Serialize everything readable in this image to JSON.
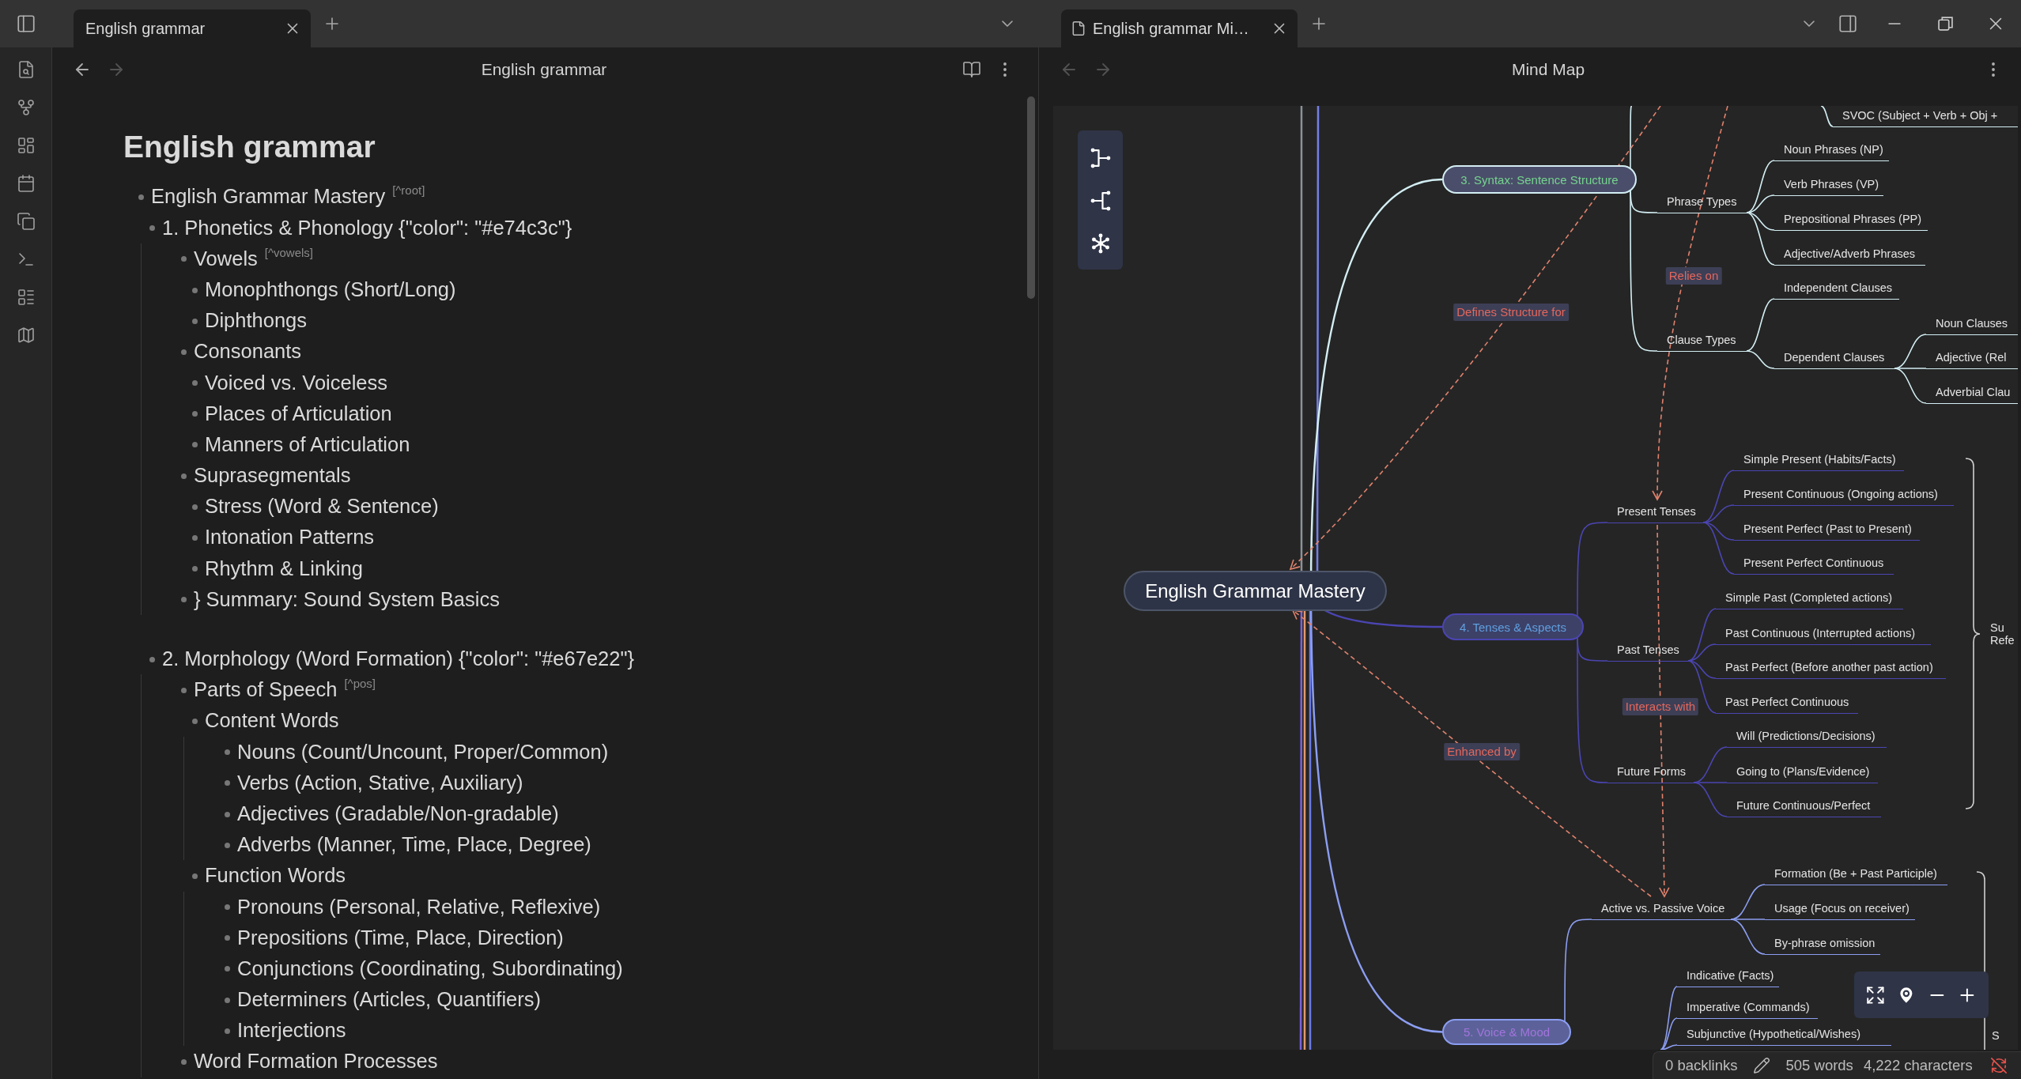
{
  "left_pane": {
    "tabs": [
      {
        "label": "English grammar",
        "selected": true
      }
    ],
    "nav_buttons": [
      {
        "kind": "back",
        "disabled": false
      },
      {
        "kind": "forward",
        "disabled": true
      }
    ],
    "header": {
      "title": "English grammar"
    },
    "note": {
      "title": "English grammar",
      "outline": [
        {
          "text": "English Grammar Mastery",
          "anchor": "[^root]",
          "children": [
            {
              "text": "1. Phonetics & Phonology {\"color\": \"#e74c3c\"}",
              "children": [
                {
                  "text": "Vowels",
                  "anchor": "[^vowels]",
                  "children": [
                    {
                      "text": "Monophthongs (Short/Long)"
                    },
                    {
                      "text": "Diphthongs"
                    }
                  ]
                },
                {
                  "text": "Consonants",
                  "children": [
                    {
                      "text": "Voiced vs. Voiceless"
                    },
                    {
                      "text": "Places of Articulation"
                    },
                    {
                      "text": "Manners of Articulation"
                    }
                  ]
                },
                {
                  "text": "Suprasegmentals",
                  "children": [
                    {
                      "text": "Stress (Word & Sentence)"
                    },
                    {
                      "text": "Intonation Patterns"
                    },
                    {
                      "text": "Rhythm & Linking"
                    }
                  ]
                },
                {
                  "text": "} Summary: Sound System Basics"
                }
              ]
            },
            {
              "text": "2. Morphology (Word Formation) {\"color\": \"#e67e22\"}",
              "children": [
                {
                  "text": "Parts of Speech",
                  "anchor": "[^pos]",
                  "children": [
                    {
                      "text": "Content Words",
                      "children": [
                        {
                          "text": "Nouns (Count/Uncount, Proper/Common)"
                        },
                        {
                          "text": "Verbs (Action, Stative, Auxiliary)"
                        },
                        {
                          "text": "Adjectives (Gradable/Non-gradable)"
                        },
                        {
                          "text": "Adverbs (Manner, Time, Place, Degree)"
                        }
                      ]
                    },
                    {
                      "text": "Function Words",
                      "children": [
                        {
                          "text": "Pronouns (Personal, Relative, Reflexive)"
                        },
                        {
                          "text": "Prepositions (Time, Place, Direction)"
                        },
                        {
                          "text": "Conjunctions (Coordinating, Subordinating)"
                        },
                        {
                          "text": "Determiners (Articles, Quantifiers)"
                        },
                        {
                          "text": "Interjections"
                        }
                      ]
                    }
                  ]
                },
                {
                  "text": "Word Formation Processes"
                }
              ]
            }
          ]
        }
      ]
    }
  },
  "right_pane": {
    "tabs": [
      {
        "label": "English grammar Mi…",
        "selected": true
      }
    ],
    "nav_buttons": [
      {
        "kind": "back",
        "disabled": true
      },
      {
        "kind": "forward",
        "disabled": true
      }
    ],
    "header": {
      "title": "Mind Map"
    },
    "mind_map": {
      "root": {
        "label": "English Grammar Mastery"
      },
      "branches": [
        {
          "label": "3. Syntax: Sentence Structure",
          "color": "#d3eef3",
          "children": [
            {
              "children": [
                {
                  "label": "SVOC (Subject + Verb + Obj +"
                }
              ]
            },
            {
              "label": "Phrase Types",
              "children": [
                {
                  "label": "Noun Phrases (NP)"
                },
                {
                  "label": "Verb Phrases (VP)"
                },
                {
                  "label": "Prepositional Phrases (PP)"
                },
                {
                  "label": "Adjective/Adverb Phrases"
                }
              ]
            },
            {
              "label": "Clause Types",
              "children": [
                {
                  "label": "Independent Clauses"
                },
                {
                  "label": "Dependent Clauses",
                  "children": [
                    {
                      "label": "Noun Clauses"
                    },
                    {
                      "label": "Adjective (Rel"
                    },
                    {
                      "label": "Adverbial Clau"
                    }
                  ]
                }
              ]
            }
          ]
        },
        {
          "label": "4. Tenses & Aspects",
          "color": "#4b45b2",
          "children": [
            {
              "label": "Present Tenses",
              "children": [
                {
                  "label": "Simple Present (Habits/Facts)"
                },
                {
                  "label": "Present Continuous (Ongoing actions)"
                },
                {
                  "label": "Present Perfect (Past to Present)"
                },
                {
                  "label": "Present Perfect Continuous"
                }
              ]
            },
            {
              "label": "Past Tenses",
              "children": [
                {
                  "label": "Simple Past (Completed actions)"
                },
                {
                  "label": "Past Continuous (Interrupted actions)"
                },
                {
                  "label": "Past Perfect (Before another past action)"
                },
                {
                  "label": "Past Perfect Continuous"
                }
              ]
            },
            {
              "label": "Future Forms",
              "children": [
                {
                  "label": "Will (Predictions/Decisions)"
                },
                {
                  "label": "Going to (Plans/Evidence)"
                },
                {
                  "label": "Future Continuous/Perfect"
                }
              ]
            }
          ],
          "summary": {
            "lines": [
              "Su",
              "Refe"
            ]
          }
        },
        {
          "label": "5. Voice & Mood",
          "color": "#8c9ef2",
          "children": [
            {
              "label": "Active vs. Passive Voice",
              "children": [
                {
                  "label": "Formation (Be + Past Participle)"
                },
                {
                  "label": "Usage (Focus on receiver)"
                },
                {
                  "label": "By-phrase omission"
                }
              ]
            },
            {
              "children": [
                {
                  "label": "Indicative (Facts)"
                },
                {
                  "label": "Imperative (Commands)"
                },
                {
                  "label": "Subjunctive (Hypothetical/Wishes)"
                }
              ]
            }
          ],
          "summary": {
            "lines": [
              "S"
            ]
          }
        }
      ],
      "links": [
        {
          "label": "Defines Structure for"
        },
        {
          "label": "Relies on"
        },
        {
          "label": "Interacts with"
        },
        {
          "label": "Enhanced by"
        }
      ]
    }
  },
  "status_bar": {
    "backlinks": "0 backlinks",
    "words": "505 words",
    "characters": "4,222 characters"
  }
}
